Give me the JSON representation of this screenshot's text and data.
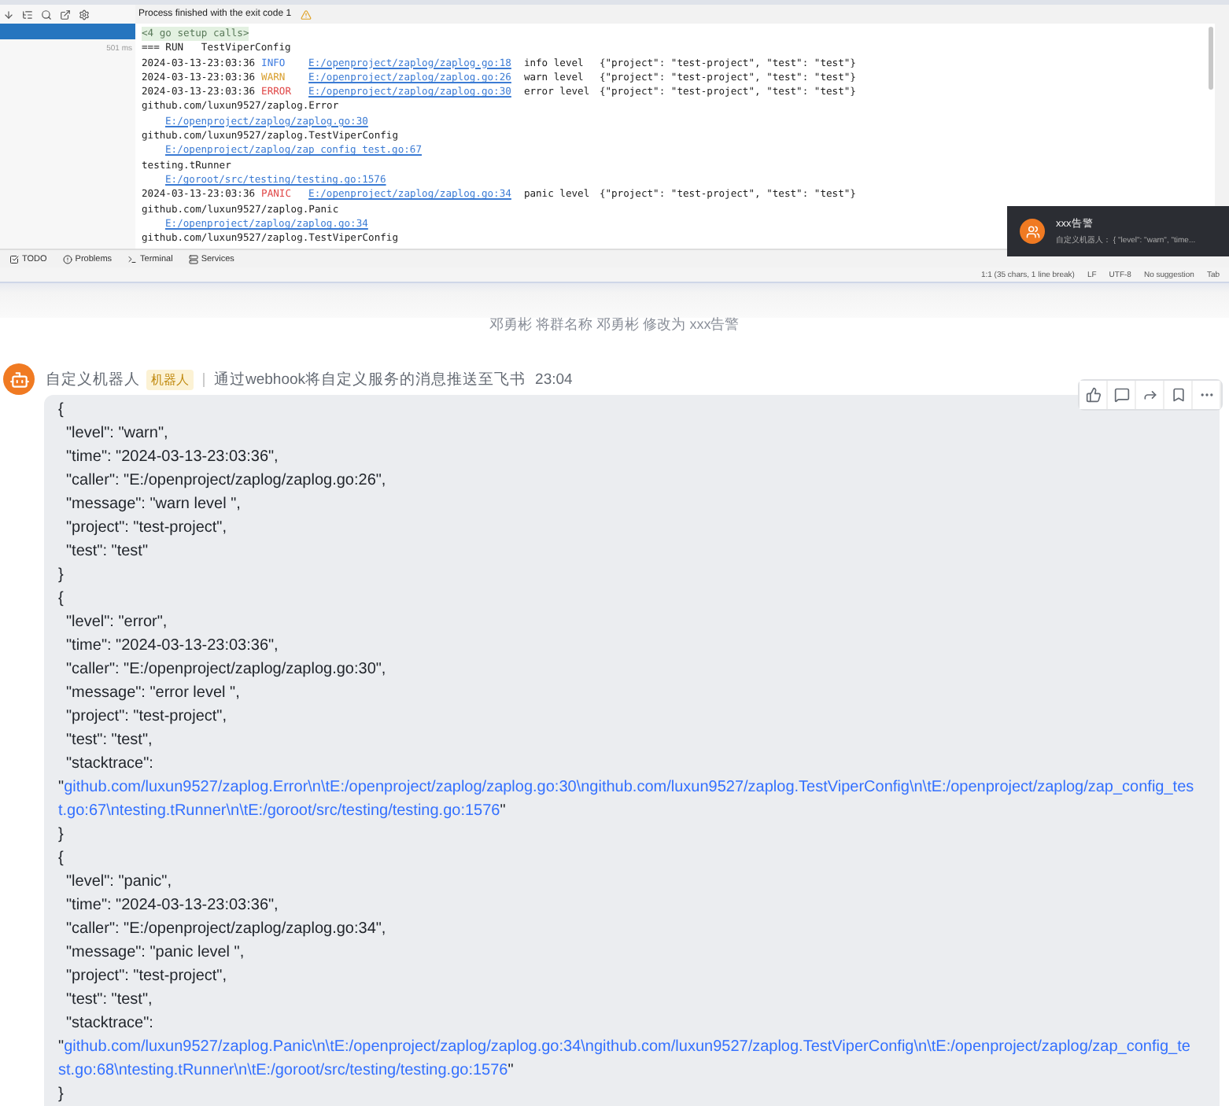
{
  "ide": {
    "run_time": "501 ms",
    "process_status": "Process finished with the exit code 1",
    "console": [
      {
        "kind": "header",
        "text": "<4 go setup calls>"
      },
      {
        "kind": "plain",
        "text": "=== RUN   TestViperConfig"
      },
      {
        "kind": "log",
        "time": "2024-03-13-23:03:36",
        "level": "INFO",
        "color": "#3d7be0",
        "link": "E:/openproject/zaplog/zaplog.go:18",
        "message": "info level",
        "fields": "{\"project\": \"test-project\", \"test\": \"test\"}"
      },
      {
        "kind": "log",
        "time": "2024-03-13-23:03:36",
        "level": "WARN",
        "color": "#d9a030",
        "link": "E:/openproject/zaplog/zaplog.go:26",
        "message": "warn level",
        "fields": "{\"project\": \"test-project\", \"test\": \"test\"}"
      },
      {
        "kind": "log",
        "time": "2024-03-13-23:03:36",
        "level": "ERROR",
        "color": "#e04848",
        "link": "E:/openproject/zaplog/zaplog.go:30",
        "message": "error level",
        "fields": "{\"project\": \"test-project\", \"test\": \"test\"}"
      },
      {
        "kind": "plain",
        "text": "github.com/luxun9527/zaplog.Error"
      },
      {
        "kind": "link",
        "text": "E:/openproject/zaplog/zaplog.go:30"
      },
      {
        "kind": "plain",
        "text": "github.com/luxun9527/zaplog.TestViperConfig"
      },
      {
        "kind": "link",
        "text": "E:/openproject/zaplog/zap_config_test.go:67"
      },
      {
        "kind": "plain",
        "text": "testing.tRunner"
      },
      {
        "kind": "link",
        "text": "E:/goroot/src/testing/testing.go:1576"
      },
      {
        "kind": "log",
        "time": "2024-03-13-23:03:36",
        "level": "PANIC",
        "color": "#e04848",
        "link": "E:/openproject/zaplog/zaplog.go:34",
        "message": "panic level",
        "fields": "{\"project\": \"test-project\", \"test\": \"test\"}"
      },
      {
        "kind": "plain",
        "text": "github.com/luxun9527/zaplog.Panic"
      },
      {
        "kind": "link",
        "text": "E:/openproject/zaplog/zaplog.go:34"
      },
      {
        "kind": "plain",
        "text": "github.com/luxun9527/zaplog.TestViperConfig"
      }
    ],
    "tool_tabs": [
      "TODO",
      "Problems",
      "Terminal",
      "Services"
    ],
    "status_items": [
      "1:1 (35 chars, 1 line break)",
      "LF",
      "UTF-8",
      "No suggestion",
      "Tab"
    ]
  },
  "notification": {
    "title": "xxx告警",
    "text": "自定义机器人： {  \"level\": \"warn\",  \"time..."
  },
  "chat": {
    "system_message": "邓勇彬 将群名称 邓勇彬 修改为 xxx告警",
    "message": {
      "sender": "自定义机器人",
      "badge": "机器人",
      "description": "通过webhook将自定义服务的消息推送至飞书",
      "time": "23:04",
      "lines": [
        {
          "kind": "brace",
          "text": "{"
        },
        {
          "kind": "field",
          "text": "\"level\": \"warn\","
        },
        {
          "kind": "field",
          "text": "\"time\": \"2024-03-13-23:03:36\","
        },
        {
          "kind": "field",
          "text": "\"caller\": \"E:/openproject/zaplog/zaplog.go:26\","
        },
        {
          "kind": "field",
          "text": "\"message\": \"warn level \","
        },
        {
          "kind": "field",
          "text": "\"project\": \"test-project\","
        },
        {
          "kind": "field",
          "text": "\"test\": \"test\""
        },
        {
          "kind": "brace",
          "text": "}"
        },
        {
          "kind": "brace",
          "text": "{"
        },
        {
          "kind": "field",
          "text": "\"level\": \"error\","
        },
        {
          "kind": "field",
          "text": "\"time\": \"2024-03-13-23:03:36\","
        },
        {
          "kind": "field",
          "text": "\"caller\": \"E:/openproject/zaplog/zaplog.go:30\","
        },
        {
          "kind": "field",
          "text": "\"message\": \"error level \","
        },
        {
          "kind": "field",
          "text": "\"project\": \"test-project\","
        },
        {
          "kind": "field",
          "text": "\"test\": \"test\","
        },
        {
          "kind": "field",
          "text": "\"stacktrace\":"
        },
        {
          "kind": "trace",
          "open": "\"",
          "link": "github.com/luxun9527/zaplog.Error\\n\\tE:/openproject/zaplog/zaplog.go:30\\ngithub.com/luxun9527/zaplog.TestViperConfig\\n\\tE:/openproject/zaplog/zap_config_test.go:67\\ntesting.tRunner\\n\\tE:/goroot/src/testing/testing.go:1576",
          "close": "\""
        },
        {
          "kind": "brace",
          "text": "}"
        },
        {
          "kind": "brace",
          "text": "{"
        },
        {
          "kind": "field",
          "text": "\"level\": \"panic\","
        },
        {
          "kind": "field",
          "text": "\"time\": \"2024-03-13-23:03:36\","
        },
        {
          "kind": "field",
          "text": "\"caller\": \"E:/openproject/zaplog/zaplog.go:34\","
        },
        {
          "kind": "field",
          "text": "\"message\": \"panic level \","
        },
        {
          "kind": "field",
          "text": "\"project\": \"test-project\","
        },
        {
          "kind": "field",
          "text": "\"test\": \"test\","
        },
        {
          "kind": "field",
          "text": "\"stacktrace\":"
        },
        {
          "kind": "trace",
          "open": "\"",
          "link": "github.com/luxun9527/zaplog.Panic\\n\\tE:/openproject/zaplog/zaplog.go:34\\ngithub.com/luxun9527/zaplog.TestViperConfig\\n\\tE:/openproject/zaplog/zap_config_test.go:68\\ntesting.tRunner\\n\\tE:/goroot/src/testing/testing.go:1576",
          "close": "\""
        },
        {
          "kind": "brace",
          "text": "}"
        }
      ]
    }
  }
}
